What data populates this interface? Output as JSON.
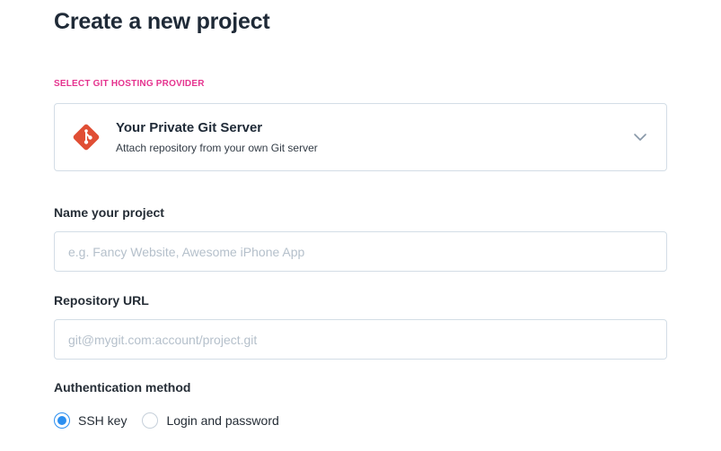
{
  "page": {
    "title": "Create a new project"
  },
  "provider": {
    "section_label": "SELECT GIT HOSTING PROVIDER",
    "selected_name": "Your Private Git Server",
    "selected_description": "Attach repository from your own Git server",
    "icon": "git-logo-icon",
    "icon_color": "#e04e34"
  },
  "project_name": {
    "label": "Name your project",
    "value": "",
    "placeholder": "e.g. Fancy Website, Awesome iPhone App"
  },
  "repository_url": {
    "label": "Repository URL",
    "value": "",
    "placeholder": "git@mygit.com:account/project.git"
  },
  "auth": {
    "label": "Authentication method",
    "options": [
      {
        "label": "SSH key",
        "selected": true
      },
      {
        "label": "Login and password",
        "selected": false
      }
    ]
  },
  "colors": {
    "accent_pink": "#e5348f",
    "radio_blue": "#2c8ff0",
    "border": "#d3dde6"
  }
}
